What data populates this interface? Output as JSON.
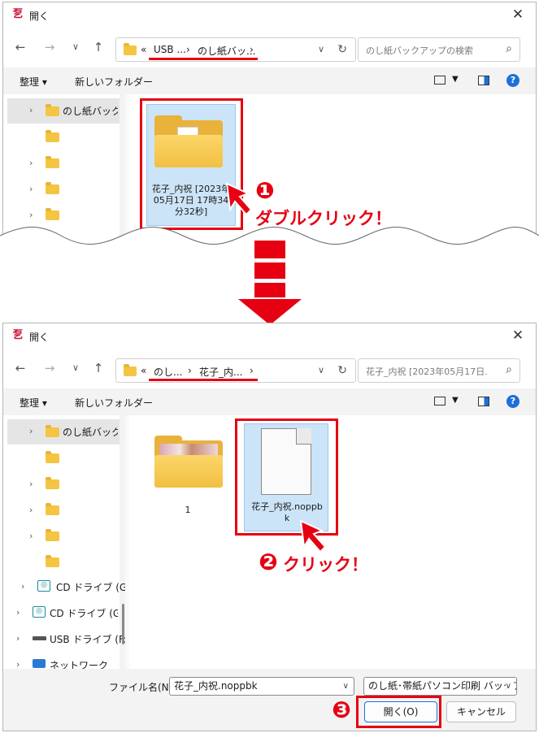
{
  "dialog1": {
    "title": "開く",
    "address": {
      "prefix": "«",
      "crumb1": "USB ...",
      "sep": "›",
      "crumb2": "のし紙バッ...",
      "sep2": "›"
    },
    "search_placeholder": "のし紙バックアップの検索",
    "toolbar": {
      "organize": "整理 ▾",
      "new_folder": "新しいフォルダー",
      "help": "?"
    },
    "nav": {
      "selected": "のし紙バックア"
    },
    "item": {
      "label": "花子_内祝 [2023年05月17日 17時34分32秒]"
    },
    "callout_num": "❶",
    "callout_text": "ダブルクリック！"
  },
  "dialog2": {
    "title": "開く",
    "address": {
      "prefix": "«",
      "crumb1": "のし...",
      "sep": "›",
      "crumb2": "花子_内...",
      "sep2": "›"
    },
    "search_placeholder": "花子_内祝 [2023年05月17日...",
    "toolbar": {
      "organize": "整理 ▾",
      "new_folder": "新しいフォルダー",
      "help": "?"
    },
    "nav": {
      "selected": "のし紙バックア",
      "drives": [
        "CD ドライブ (G:)",
        "CD ドライブ (G:) A",
        "USB ドライブ (F:)",
        "ネットワーク"
      ]
    },
    "items": [
      {
        "label": "1"
      },
      {
        "label": "花子_内祝.noppbk"
      }
    ],
    "callout2_num": "❷",
    "callout2_text": "クリック！",
    "callout3_num": "❸",
    "bottom": {
      "filename_label": "ファイル名(N):",
      "filename_value": "花子_内祝.noppbk",
      "filter_value": "のし紙･帯紙パソコン印刷 バックアップ",
      "open_button": "開く(O)",
      "cancel_button": "キャンセル"
    }
  },
  "colors": {
    "accent": "#e60012",
    "selection": "#cce4f7",
    "folder": "#f4c542"
  }
}
